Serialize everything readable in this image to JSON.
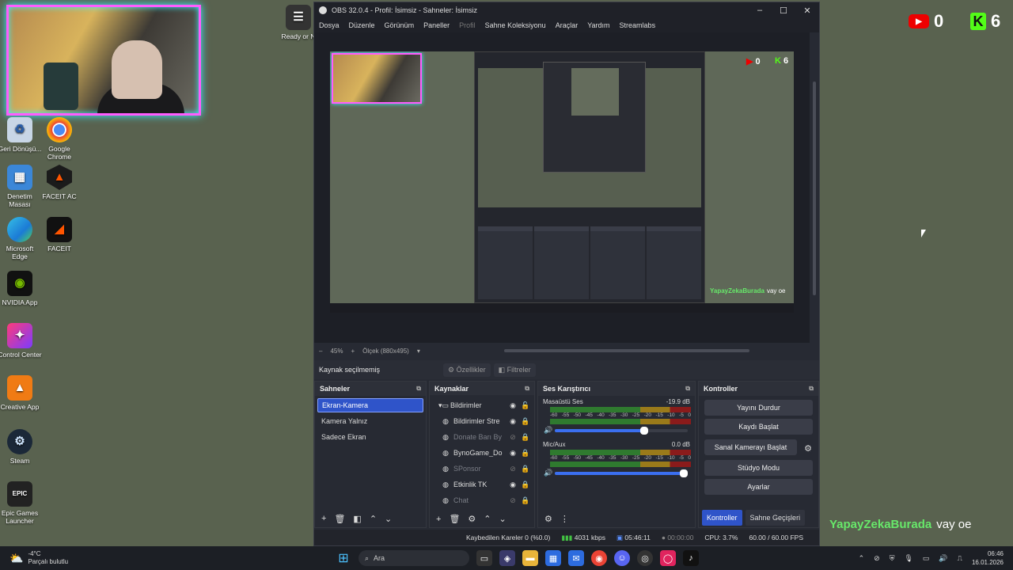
{
  "overlay": {
    "youtube_count": "0",
    "kick_count": "6",
    "chat_user": "YapayZekaBurada",
    "chat_message": "vay oe"
  },
  "desktop_icons": [
    {
      "label": "Geri Dönüşü...",
      "icon": "recycle-bin-icon"
    },
    {
      "label": "Google Chrome",
      "icon": "chrome-icon"
    },
    {
      "label": "Denetim Masası",
      "icon": "control-panel-icon"
    },
    {
      "label": "FACEIT AC",
      "icon": "faceit-ac-icon"
    },
    {
      "label": "Microsoft Edge",
      "icon": "edge-icon"
    },
    {
      "label": "FACEIT",
      "icon": "faceit-icon"
    },
    {
      "label": "NVIDIA App",
      "icon": "nvidia-icon"
    },
    {
      "label": "Control Center",
      "icon": "control-center-icon"
    },
    {
      "label": "Creative App",
      "icon": "creative-app-icon"
    },
    {
      "label": "Steam",
      "icon": "steam-icon"
    },
    {
      "label": "Epic Games Launcher",
      "icon": "epic-games-icon"
    }
  ],
  "partial_label": "Ready or N",
  "obs": {
    "title": "OBS 32.0.4 - Profil: İsimsiz - Sahneler: İsimsiz",
    "menu": [
      "Dosya",
      "Düzenle",
      "Görünüm",
      "Paneller",
      "Profil",
      "Sahne Koleksiyonu",
      "Araçlar",
      "Yardım",
      "Streamlabs"
    ],
    "zoom": "45%",
    "scale_label": "Ölçek (880x495)",
    "context": {
      "no_source": "Kaynak seçilmemiş",
      "properties": "Özellikler",
      "filters": "Filtreler"
    },
    "scenes": {
      "title": "Sahneler",
      "items": [
        "Ekran-Kamera",
        "Kamera Yalnız",
        "Sadece Ekran"
      ]
    },
    "sources": {
      "title": "Kaynaklar",
      "items": [
        {
          "name": "Bildirimler",
          "dim": false
        },
        {
          "name": "Bildirimler Stre",
          "dim": false
        },
        {
          "name": "Donate Barı By",
          "dim": true
        },
        {
          "name": "BynoGame_Do",
          "dim": false
        },
        {
          "name": "SPonsor",
          "dim": true
        },
        {
          "name": "Etkinlik TK",
          "dim": false
        },
        {
          "name": "Chat",
          "dim": true
        }
      ]
    },
    "mixer": {
      "title": "Ses Karıştırıcı",
      "channels": [
        {
          "name": "Masaüstü Ses",
          "db": "-19.9 dB",
          "volume": 0.7
        },
        {
          "name": "Mic/Aux",
          "db": "0.0 dB",
          "volume": 1.0
        }
      ],
      "scale": [
        "-60",
        "-55",
        "-50",
        "-45",
        "-40",
        "-35",
        "-30",
        "-25",
        "-20",
        "-15",
        "-10",
        "-5",
        "0"
      ]
    },
    "controls": {
      "title": "Kontroller",
      "stop_stream": "Yayını Durdur",
      "start_record": "Kaydı Başlat",
      "start_vcam": "Sanal Kamerayı Başlat",
      "studio_mode": "Stüdyo Modu",
      "settings": "Ayarlar",
      "tab_controls": "Kontroller",
      "tab_transitions": "Sahne Geçişleri"
    },
    "status": {
      "dropped": "Kaybedilen Kareler 0 (%0.0)",
      "bitrate": "4031 kbps",
      "stream_time": "05:46:11",
      "record_time": "00:00:00",
      "cpu": "CPU: 3.7%",
      "fps": "60.00 / 60.00 FPS"
    }
  },
  "taskbar": {
    "temp": "-4°C",
    "weather": "Parçalı bulutlu",
    "search": "Ara",
    "time": "06:46",
    "date": "16.01.2026"
  },
  "colors": {
    "accent": "#2f54c9",
    "kick": "#53fc18",
    "youtube": "#ee0000"
  }
}
